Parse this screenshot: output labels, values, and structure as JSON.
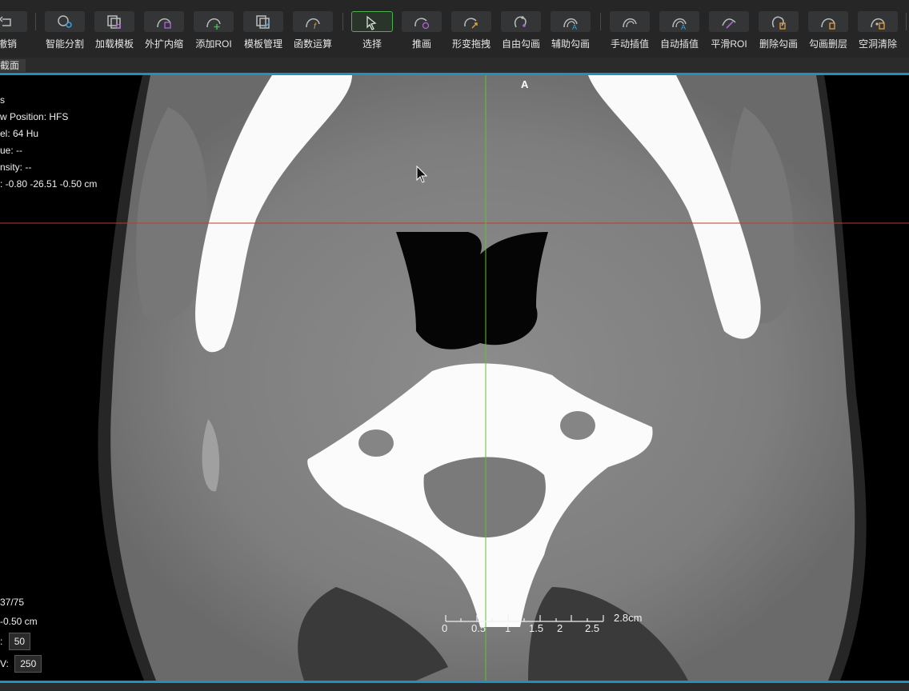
{
  "toolbar": {
    "items": [
      {
        "label": "撤销",
        "icon": "undo-icon"
      },
      {
        "label": "智能分割",
        "icon": "smart-segment-icon"
      },
      {
        "label": "加载模板",
        "icon": "load-template-icon"
      },
      {
        "label": "外扩内缩",
        "icon": "expand-shrink-icon"
      },
      {
        "label": "添加ROI",
        "icon": "add-roi-icon"
      },
      {
        "label": "模板管理",
        "icon": "template-manage-icon"
      },
      {
        "label": "函数运算",
        "icon": "function-calc-icon"
      },
      {
        "label": "选择",
        "icon": "select-arrow-icon"
      },
      {
        "label": "推画",
        "icon": "push-draw-icon"
      },
      {
        "label": "形变拖拽",
        "icon": "deform-drag-icon"
      },
      {
        "label": "自由勾画",
        "icon": "free-contour-icon"
      },
      {
        "label": "辅助勾画",
        "icon": "assist-contour-icon"
      },
      {
        "label": "手动插值",
        "icon": "manual-interp-icon"
      },
      {
        "label": "自动插值",
        "icon": "auto-interp-icon"
      },
      {
        "label": "平滑ROI",
        "icon": "smooth-roi-icon"
      },
      {
        "label": "删除勾画",
        "icon": "delete-contour-icon"
      },
      {
        "label": "勾画删层",
        "icon": "delete-slice-icon"
      },
      {
        "label": "空洞清除",
        "icon": "hole-clear-icon"
      }
    ],
    "active": "选择"
  },
  "tab": {
    "label": "截面"
  },
  "overlay": {
    "line1": "s",
    "line2": "w Position: HFS",
    "line3": "el:  64 Hu",
    "line4": "ue:  --",
    "line5": "nsity:  --",
    "line6": ":  -0.80 -26.51 -0.50 cm",
    "slice": "37/75",
    "position": "-0.50 cm",
    "wl_label": ":",
    "wl_value": "50",
    "ww_label": "V:",
    "ww_value": "250",
    "orientation": "A"
  },
  "scale": {
    "ticks": [
      "0",
      "0.5",
      "1",
      "1.5",
      "2",
      "2.5"
    ],
    "length_label": "2.8cm"
  },
  "colors": {
    "accent_border": "#1f8fc4",
    "crosshair_vertical": "#5fc33a",
    "crosshair_horizontal": "#c0392b",
    "active_tool": "#4caf50"
  }
}
